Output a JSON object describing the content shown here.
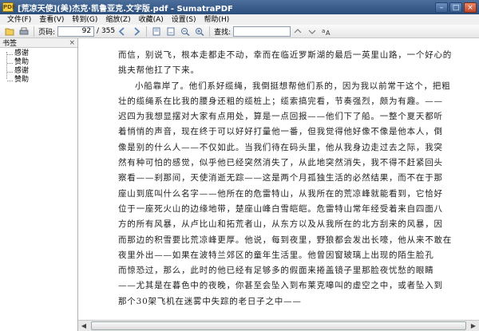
{
  "window": {
    "app_icon": "sumatra-icon",
    "title": "[荒凉天使](美)杰克·凯鲁亚克.文字版.pdf - SumatraPDF",
    "buttons": [
      "minimize",
      "maximize",
      "close"
    ]
  },
  "menu": [
    "文件(F)",
    "查看(V)",
    "转到(G)",
    "缩放(Z)",
    "收藏(A)",
    "设置(S)",
    "帮助(H)"
  ],
  "toolbar": {
    "page_label": "页码:",
    "page_value": "92",
    "page_total": "/ 355",
    "search_label": "查找:",
    "icons": [
      "open-icon",
      "print-icon",
      "prev-page-icon",
      "next-page-icon",
      "fit-page-icon",
      "fit-width-icon",
      "zoom-out-icon",
      "zoom-in-icon",
      "match-case-icon"
    ]
  },
  "sidebar": {
    "title": "书签",
    "close": "×",
    "items": [
      "感谢",
      "赞助",
      "感谢",
      "赞助"
    ]
  },
  "document": {
    "lines": [
      "而信，别说飞，根本走都走不动，幸而在临近罗斯湖的最后一英里山路，一个好心的",
      "挑夫帮他扛了下来。",
      "小船靠岸了。他们系好缆绳，我倒挺想帮他们系的，因为我以前常干这个，把粗",
      "壮的缆绳系在比我的腰身还粗的缆桩上；缆索搞完看，节奏强烈，颇为有趣。——",
      "迟四为我想显摆对大家有点用处，算是一点回报——他们下了船。一整个夏天都听",
      "着悄悄的声音，现在终于可以好好打量他一番，但我觉得他好像不像是他本人，倒",
      "像是别的什么人——不仅如此。当我们待在码头里，他从我身边走过去之际，我突",
      "然有种可怕的感觉，似乎他已经突然消失了，从此地突然消失，我不得不赶紧回头",
      "察看——刹那间，天使消逝无踪——这是两个月孤独生活的必然结果，而不在于那",
      "座山到底叫什么名字——他所在的危雷特山，从我所在的荒凉峰就能看到，它恰好",
      "位于一座死火山的边缘地带，楚座山峰白雪皑皑。危雷特山常年经受着来自四面八",
      "方的所有风暴，从卢比山和拓荒者山，从东方以及从我所在的北方刮来的风暴，因",
      "而那边的积雪要比荒凉峰更厚。他说，每到夜里，野狼都会发出长嚎，他从来不敢在",
      "夜里外出——如果在波特兰郊区的童年生活里。他曾因窗玻璃上出现的陌生脸孔",
      "而惊恐过，那么，此时的他已经有足够多的假面来捲盖镜子里那脸夜忧愁的眼睛",
      "——尤其是在暮色中的夜晚，你甚至会坠入到布莱克嗥叫的虚空之中，或者坠入到",
      "那个30架飞机在迷雾中失踪的老日子之中——"
    ]
  }
}
